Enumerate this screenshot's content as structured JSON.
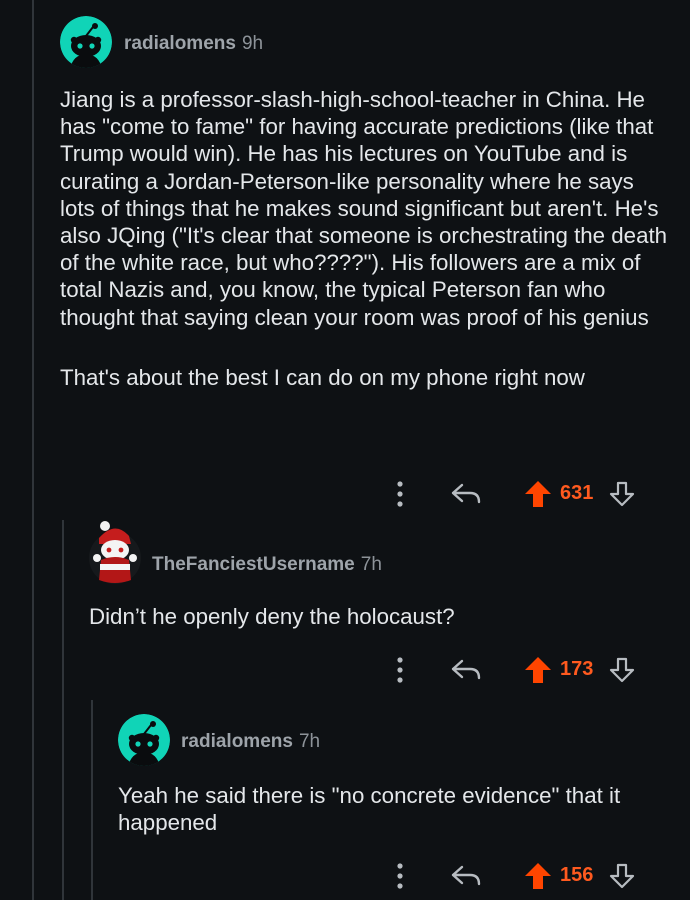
{
  "colors": {
    "background": "#0e1114",
    "upvote_accent": "#ff4500",
    "avatar_teal": "#10d4b7",
    "username_gray": "#9ea4aa"
  },
  "comments": [
    {
      "username": "radialomens",
      "timestamp": "9h",
      "avatar": "snoo-teal-avatar",
      "paragraphs": [
        "Jiang is a professor-slash-high-school-teacher in China. He has \"come to fame\" for having accurate predictions (like that Trump would win). He has his lectures on YouTube and is curating a Jordan-Peterson-like personality where he says lots of things that he makes sound significant but aren't. He's also JQing (\"It's clear that someone is orchestrating the death of the white race, but who????\"). His followers are a mix of total Nazis and, you know, the typical Peterson fan who thought that saying clean your room was proof of his genius",
        "That's about the best I can do on my phone right now"
      ],
      "votes": "631"
    },
    {
      "username": "TheFanciestUsername",
      "timestamp": "7h",
      "avatar": "snoo-red-costume-avatar",
      "paragraphs": [
        "Didn’t he openly deny the holocaust?"
      ],
      "votes": "173"
    },
    {
      "username": "radialomens",
      "timestamp": "7h",
      "avatar": "snoo-teal-avatar",
      "paragraphs": [
        "Yeah he said there is \"no concrete evidence\" that it happened"
      ],
      "votes": "156"
    }
  ]
}
